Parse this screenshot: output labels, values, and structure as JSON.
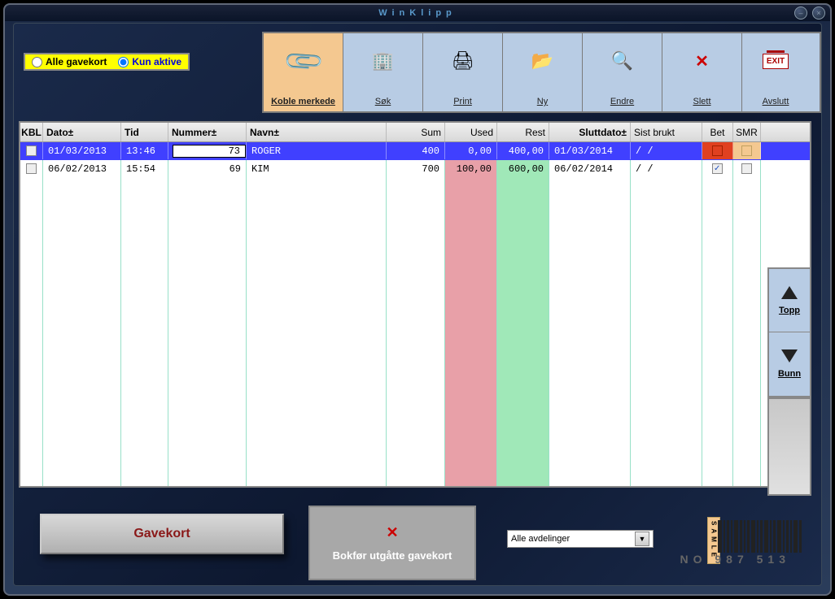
{
  "title": "WinKlipp",
  "filters": {
    "all_label": "Alle gavekort",
    "active_label": "Kun aktive",
    "selected": "active"
  },
  "toolbar": [
    {
      "id": "koble",
      "label": "Koble merkede",
      "active": true
    },
    {
      "id": "sok",
      "label": "Søk"
    },
    {
      "id": "print",
      "label": "Print"
    },
    {
      "id": "ny",
      "label": "Ny"
    },
    {
      "id": "endre",
      "label": "Endre"
    },
    {
      "id": "slett",
      "label": "Slett"
    },
    {
      "id": "avslutt",
      "label": "Avslutt"
    }
  ],
  "columns": {
    "kbl": "KBL",
    "dato": "Dato±",
    "tid": "Tid",
    "nummer": "Nummer±",
    "navn": "Navn±",
    "sum": "Sum",
    "used": "Used",
    "rest": "Rest",
    "sluttdato": "Sluttdato±",
    "sistbrukt": "Sist brukt",
    "bet": "Bet",
    "smr": "SMR"
  },
  "rows": [
    {
      "kbl": false,
      "dato": "01/03/2013",
      "tid": "13:46",
      "nummer": "73",
      "navn": "ROGER",
      "sum": "400",
      "used": "0,00",
      "rest": "400,00",
      "sluttdato": "01/03/2014",
      "sistbrukt": "/  /",
      "bet": false,
      "bet_style": "red",
      "smr_style": "orange",
      "selected": true,
      "editing": true
    },
    {
      "kbl": false,
      "dato": "06/02/2013",
      "tid": "15:54",
      "nummer": "69",
      "navn": "KIM",
      "sum": "700",
      "used": "100,00",
      "rest": "600,00",
      "sluttdato": "06/02/2014",
      "sistbrukt": "/  /",
      "bet": true,
      "selected": false
    }
  ],
  "side": {
    "topp": "Topp",
    "bunn": "Bunn"
  },
  "bottom": {
    "gavekort": "Gavekort",
    "bokfor": "Bokfør utgåtte gavekort",
    "dept": "Alle avdelinger",
    "vat": "NO 987    513",
    "sample": "SAMLE"
  }
}
